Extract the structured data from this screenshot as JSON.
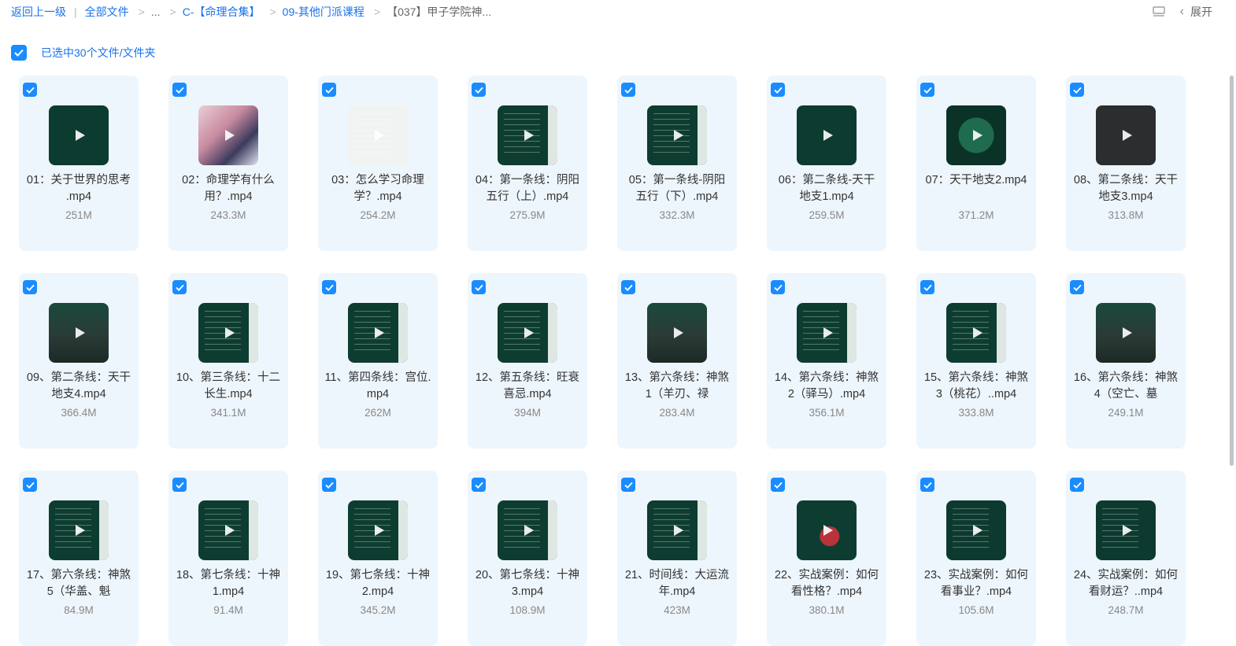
{
  "breadcrumb": {
    "back": "返回上一级",
    "all_files": "全部文件",
    "ellipsis": "...",
    "c1": "C-【命理合集】",
    "c2": "09-其他门派课程",
    "current": "【037】甲子学院神..."
  },
  "toolbar": {
    "expand_label": "展开",
    "icons": [
      "list-view-icon",
      "chevron-left-icon"
    ]
  },
  "selection": {
    "label": "已选中30个文件/文件夹",
    "checked": true
  },
  "colors": {
    "accent": "#1a8cff",
    "card_bg": "#eef6fd",
    "thumb_dark": "#0e3b2e"
  },
  "files": [
    {
      "name": "01：关于世界的思考 .mp4",
      "size": "251M",
      "thumb": "dark"
    },
    {
      "name": "02：命理学有什么用？.mp4",
      "size": "243.3M",
      "thumb": "photo"
    },
    {
      "name": "03：怎么学习命理学？.mp4",
      "size": "254.2M",
      "thumb": "light"
    },
    {
      "name": "04：第一条线：阴阳五行（上）.mp4",
      "size": "275.9M",
      "thumb": "slide"
    },
    {
      "name": "05：第一条线-阴阳五行（下）.mp4",
      "size": "332.3M",
      "thumb": "slide"
    },
    {
      "name": "06：第二条线-天干地支1.mp4",
      "size": "259.5M",
      "thumb": "dark"
    },
    {
      "name": "07：天干地支2.mp4",
      "size": "371.2M",
      "thumb": "wheel"
    },
    {
      "name": "08、第二条线：天干地支3.mp4",
      "size": "313.8M",
      "thumb": "gray"
    },
    {
      "name": "09、第二条线：天干地支4.mp4",
      "size": "366.4M",
      "thumb": "cartoon"
    },
    {
      "name": "10、第三条线：十二长生.mp4",
      "size": "341.1M",
      "thumb": "slide"
    },
    {
      "name": "11、第四条线：宫位.mp4",
      "size": "262M",
      "thumb": "slide"
    },
    {
      "name": "12、第五条线：旺衰喜忌.mp4",
      "size": "394M",
      "thumb": "slide"
    },
    {
      "name": "13、第六条线：神煞1（羊刃、禄",
      "size": "283.4M",
      "thumb": "cartoon"
    },
    {
      "name": "14、第六条线：神煞2（驿马）.mp4",
      "size": "356.1M",
      "thumb": "slide"
    },
    {
      "name": "15、第六条线：神煞3（桃花）..mp4",
      "size": "333.8M",
      "thumb": "slide"
    },
    {
      "name": "16、第六条线：神煞4（空亡、墓",
      "size": "249.1M",
      "thumb": "cartoon"
    },
    {
      "name": "17、第六条线：神煞5（华盖、魁",
      "size": "84.9M",
      "thumb": "slide"
    },
    {
      "name": "18、第七条线：十神1.mp4",
      "size": "91.4M",
      "thumb": "slide"
    },
    {
      "name": "19、第七条线：十神2.mp4",
      "size": "345.2M",
      "thumb": "slide"
    },
    {
      "name": "20、第七条线：十神3.mp4",
      "size": "108.9M",
      "thumb": "slide"
    },
    {
      "name": "21、时间线：大运流年.mp4",
      "size": "423M",
      "thumb": "slide"
    },
    {
      "name": "22、实战案例：如何看性格？.mp4",
      "size": "380.1M",
      "thumb": "red"
    },
    {
      "name": "23、实战案例：如何看事业？.mp4",
      "size": "105.6M",
      "thumb": "chart"
    },
    {
      "name": "24、实战案例：如何看财运？..mp4",
      "size": "248.7M",
      "thumb": "chart"
    }
  ]
}
